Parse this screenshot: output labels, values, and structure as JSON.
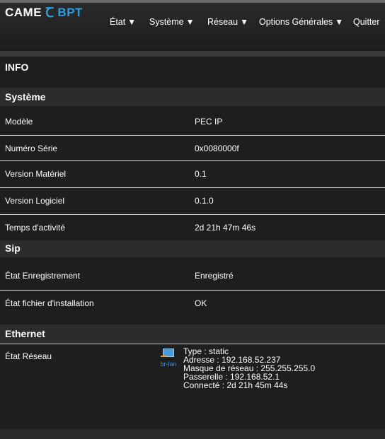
{
  "brand": {
    "came": "CAME",
    "mark": "Ꞇ",
    "bpt": "BPT"
  },
  "menu": [
    {
      "label": "État",
      "has_arrow": true
    },
    {
      "label": "Système",
      "has_arrow": true
    },
    {
      "label": "Réseau",
      "has_arrow": true
    },
    {
      "label": "Options Générales",
      "has_arrow": true
    },
    {
      "label": "Quitter",
      "has_arrow": false
    }
  ],
  "arrow": "▼",
  "page_title": "INFO",
  "sections": {
    "systeme": {
      "title": "Système",
      "rows": [
        {
          "label": "Modèle",
          "value": "PEC IP"
        },
        {
          "label": "Numéro Série",
          "value": "0x0080000f"
        },
        {
          "label": "Version Matériel",
          "value": "0.1"
        },
        {
          "label": "Version Logiciel",
          "value": "0.1.0"
        },
        {
          "label": "Temps d'activité",
          "value": "2d 21h 47m 46s"
        }
      ]
    },
    "sip": {
      "title": "Sip",
      "rows": [
        {
          "label": "État Enregistrement",
          "value": "Enregistré"
        },
        {
          "label": "État fichier d'installation",
          "value": "OK"
        }
      ]
    },
    "ethernet": {
      "title": "Ethernet",
      "label": "État Réseau",
      "interface": "br-lan",
      "details": [
        "Type : static",
        "Adresse : 192.168.52.237",
        "Masque de réseau : 255.255.255.0",
        "Passerelle : 192.168.52.1",
        "Connecté : 2d 21h 45m 44s"
      ]
    }
  },
  "colors": {
    "accent": "#2aa0e0",
    "background": "#1e1e1e",
    "section_bg": "#2c2c2c"
  }
}
